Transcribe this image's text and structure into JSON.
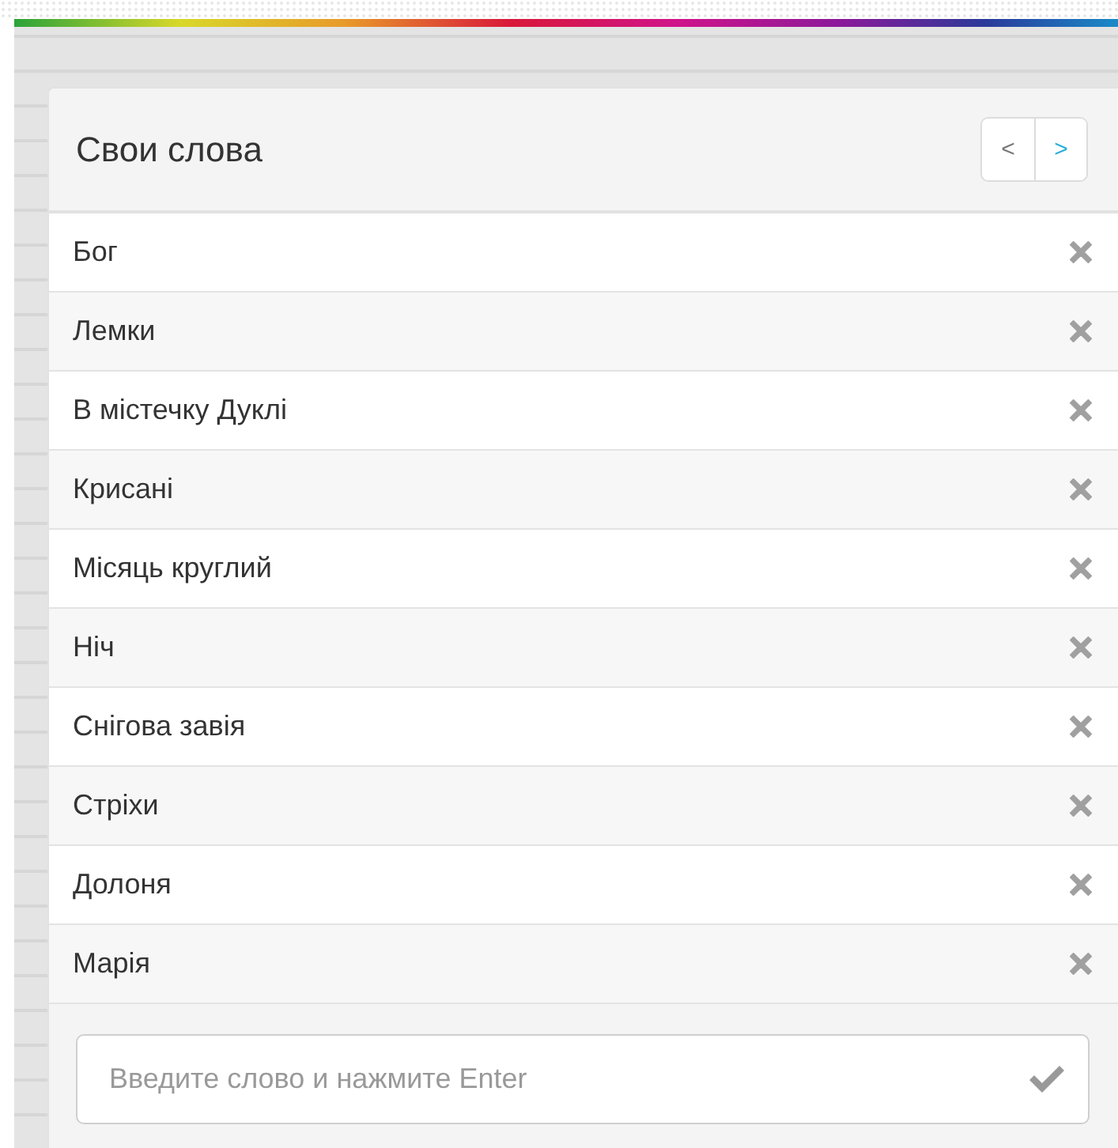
{
  "panel": {
    "title": "Свои слова",
    "nav": [
      {
        "label": "<",
        "disabled": true
      },
      {
        "label": ">",
        "disabled": false
      }
    ]
  },
  "words": [
    {
      "text": "Бог"
    },
    {
      "text": "Лемки"
    },
    {
      "text": "В містечку Дуклі"
    },
    {
      "text": "Крисані"
    },
    {
      "text": "Місяць круглий"
    },
    {
      "text": "Ніч"
    },
    {
      "text": "Снігова завія"
    },
    {
      "text": "Стріхи"
    },
    {
      "text": "Долоня"
    },
    {
      "text": "Марія"
    }
  ],
  "input": {
    "placeholder": "Введите слово и нажмите Enter"
  }
}
